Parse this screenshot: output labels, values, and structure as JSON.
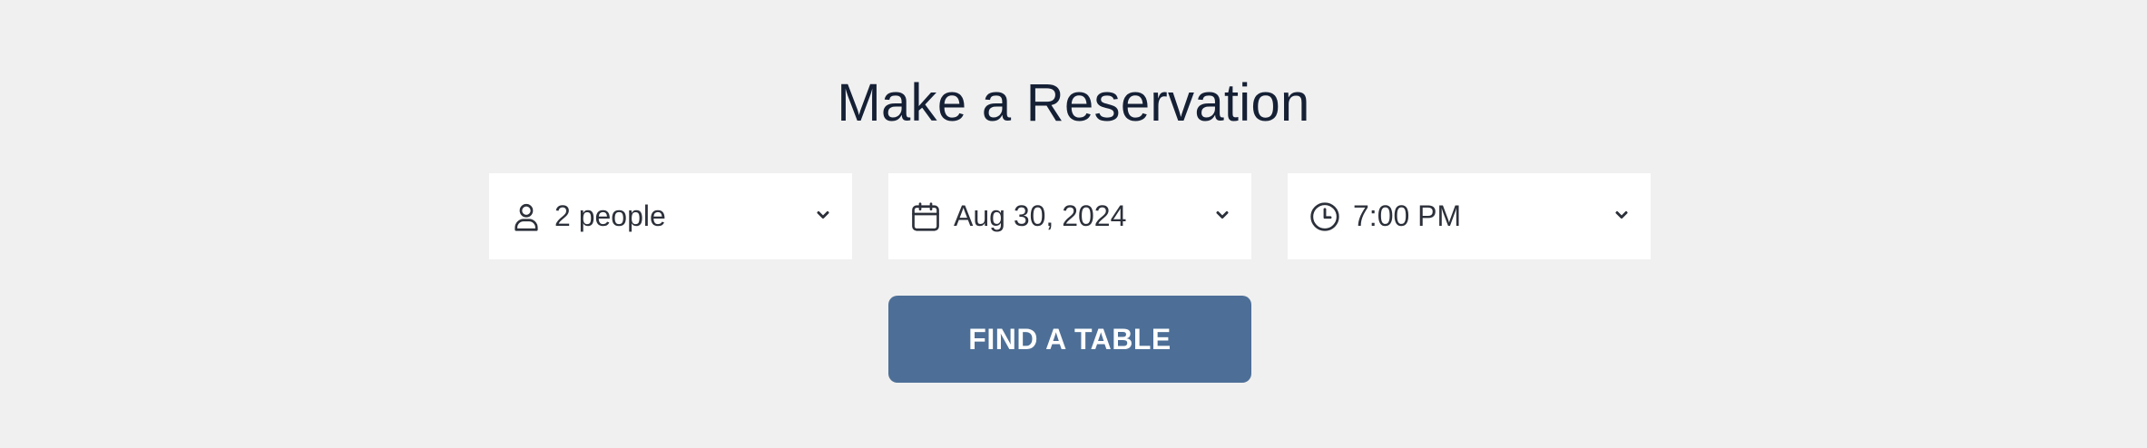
{
  "page": {
    "title": "Make a Reservation"
  },
  "form": {
    "party_size": {
      "value": "2 people",
      "icon": "person-icon"
    },
    "date": {
      "value": "Aug 30, 2024",
      "icon": "calendar-icon"
    },
    "time": {
      "value": "7:00 PM",
      "icon": "clock-icon"
    },
    "submit_label": "FIND A TABLE"
  },
  "colors": {
    "background": "#f0f0f0",
    "field_background": "#ffffff",
    "title_text": "#152035",
    "field_text": "#2c303a",
    "button_background": "#4d6f97",
    "button_text": "#ffffff"
  }
}
